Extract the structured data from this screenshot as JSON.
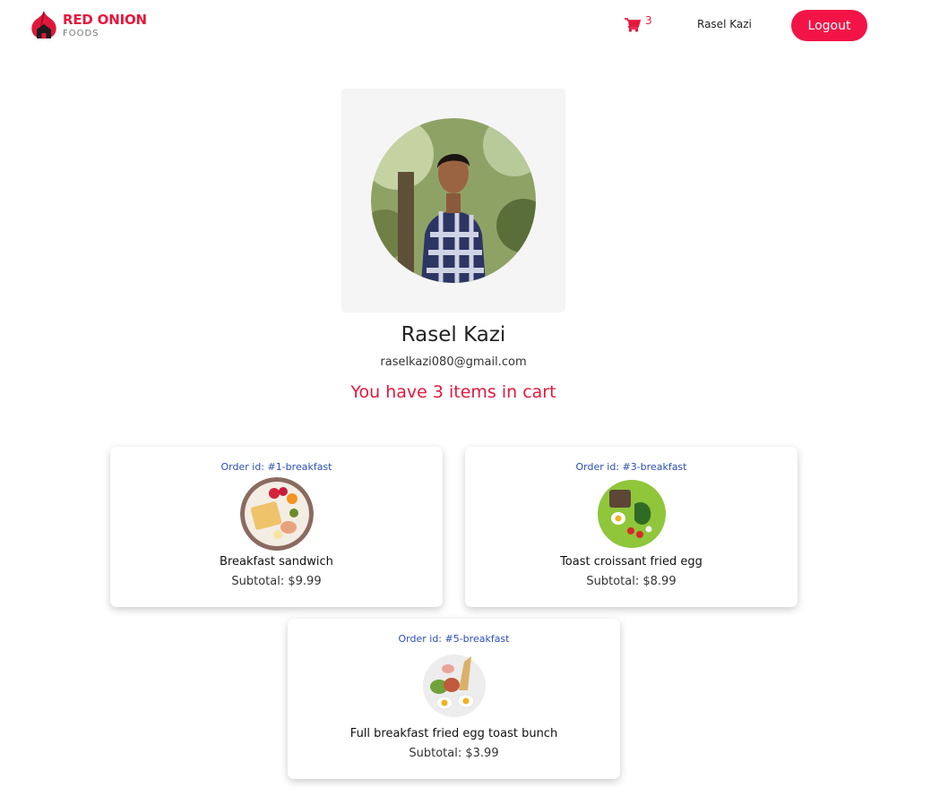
{
  "header": {
    "brand_main": "RED ONION",
    "brand_sub": "FOODS",
    "cart_icon": "cart-icon",
    "cart_count": "3",
    "username": "Rasel Kazi",
    "logout_label": "Logout"
  },
  "profile": {
    "name": "Rasel Kazi",
    "email": "raselkazi080@gmail.com",
    "cart_message": "You have 3 items in cart"
  },
  "orders": [
    {
      "order_id": "Order id: #1-breakfast",
      "title": "Breakfast sandwich",
      "subtotal": "Subtotal: $9.99"
    },
    {
      "order_id": "Order id: #3-breakfast",
      "title": "Toast croissant fried egg",
      "subtotal": "Subtotal: $8.99"
    },
    {
      "order_id": "Order id: #5-breakfast",
      "title": "Full breakfast fried egg toast bunch",
      "subtotal": "Subtotal: $3.99"
    }
  ],
  "colors": {
    "accent": "#f21447",
    "brand_red": "#e6173d",
    "order_id_blue": "#2b4eb5",
    "photo_bg": "#f5f5f5"
  }
}
